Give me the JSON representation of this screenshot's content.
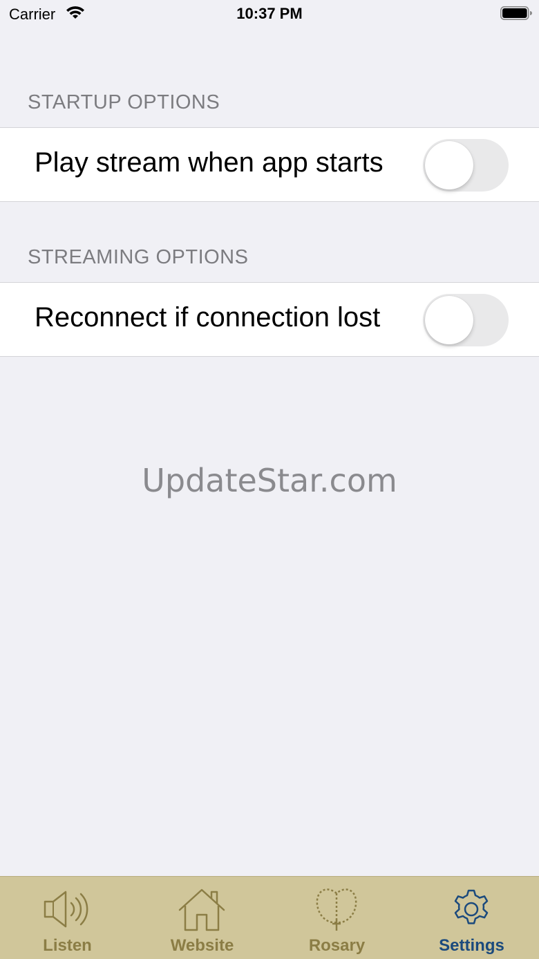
{
  "status_bar": {
    "carrier": "Carrier",
    "time": "10:37 PM"
  },
  "sections": [
    {
      "header": "STARTUP OPTIONS",
      "row_label": "Play stream when app starts",
      "toggle_on": false
    },
    {
      "header": "STREAMING OPTIONS",
      "row_label": "Reconnect if connection lost",
      "toggle_on": false
    }
  ],
  "watermark": "UpdateStar.com",
  "tab_bar": {
    "tabs": [
      {
        "label": "Listen",
        "icon": "speaker-icon"
      },
      {
        "label": "Website",
        "icon": "house-icon"
      },
      {
        "label": "Rosary",
        "icon": "rosary-icon"
      },
      {
        "label": "Settings",
        "icon": "gear-icon"
      }
    ],
    "active_tab": "Settings"
  },
  "colors": {
    "background": "#f0f0f5",
    "tab_bar": "#d0c69a",
    "tab_inactive": "#8b7d45",
    "tab_active": "#1b4a7d"
  }
}
